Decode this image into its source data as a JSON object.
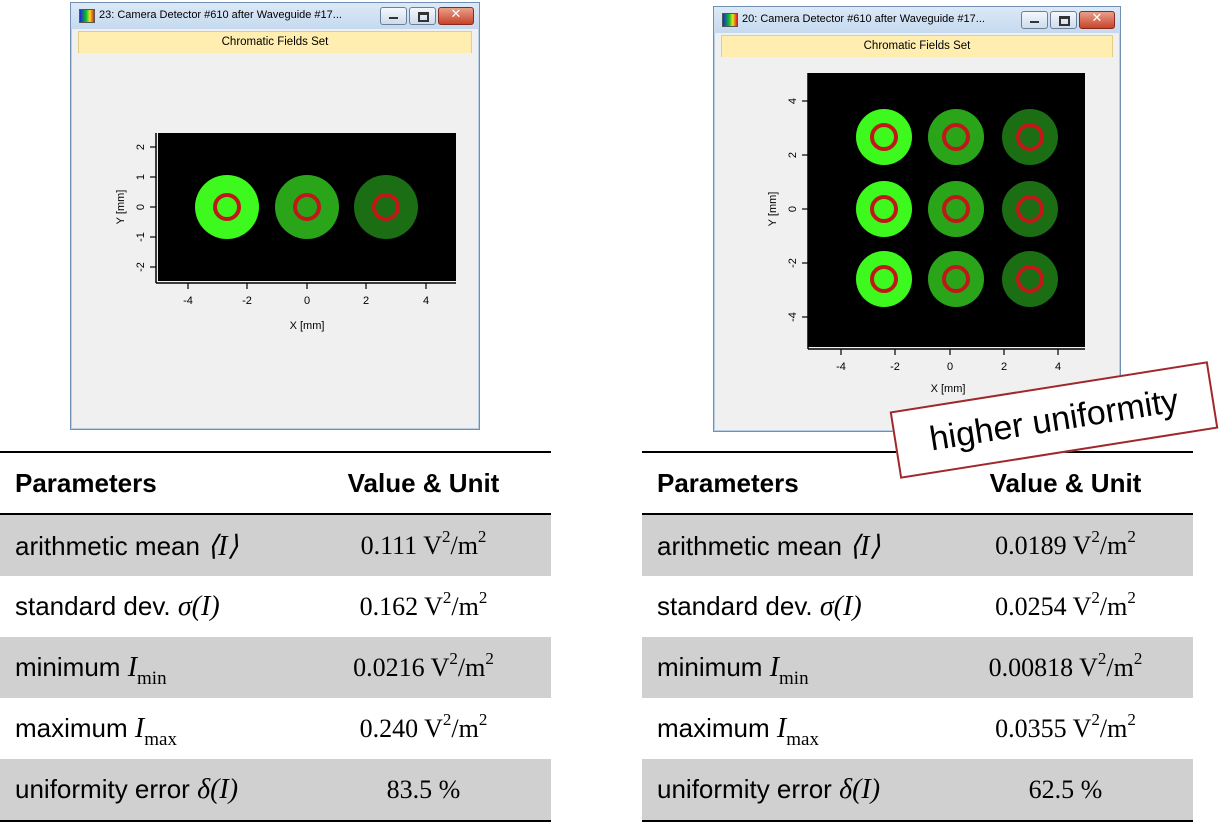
{
  "windows": [
    {
      "title": "23: Camera Detector #610 after Waveguide #17...",
      "subtitle": "Chromatic Fields Set",
      "plot": {
        "xlabel": "X [mm]",
        "ylabel": "Y [mm]",
        "xticks": [
          "-4",
          "-2",
          "0",
          "2",
          "4"
        ],
        "yticks": [
          "2",
          "1",
          "0",
          "-1",
          "-2"
        ],
        "spot_fills": [
          "#3df91d",
          "#2aa51a",
          "#1b6e13"
        ],
        "ring_color": "#c01818"
      }
    },
    {
      "title": "20: Camera Detector #610 after Waveguide #17...",
      "subtitle": "Chromatic Fields Set",
      "plot": {
        "xlabel": "X [mm]",
        "ylabel": "Y [mm]",
        "xticks": [
          "-4",
          "-2",
          "0",
          "2",
          "4"
        ],
        "yticks": [
          "4",
          "2",
          "0",
          "-2",
          "-4"
        ],
        "spot_fills": [
          "#3df91d",
          "#2aa51a",
          "#1b6e13"
        ],
        "ring_color": "#c01818"
      }
    }
  ],
  "tables": [
    {
      "header": {
        "param": "Parameters",
        "value": "Value & Unit"
      },
      "rows": [
        {
          "label": "arithmetic mean",
          "symbol": "⟨I⟩",
          "value": "0.111"
        },
        {
          "label": "standard dev.",
          "symbol": "σ(I)",
          "value": "0.162"
        },
        {
          "label": "minimum",
          "symbol": "I",
          "subscript": "min",
          "value": "0.0216"
        },
        {
          "label": "maximum",
          "symbol": "I",
          "subscript": "max",
          "value": "0.240"
        },
        {
          "label": "uniformity error",
          "symbol": "δ(I)",
          "value": "83.5 %"
        }
      ]
    },
    {
      "header": {
        "param": "Parameters",
        "value": "Value & Unit"
      },
      "rows": [
        {
          "label": "arithmetic mean",
          "symbol": "⟨I⟩",
          "value": "0.0189"
        },
        {
          "label": "standard dev.",
          "symbol": "σ(I)",
          "value": "0.0254"
        },
        {
          "label": "minimum",
          "symbol": "I",
          "subscript": "min",
          "value": "0.00818"
        },
        {
          "label": "maximum",
          "symbol": "I",
          "subscript": "max",
          "value": "0.0355"
        },
        {
          "label": "uniformity error",
          "symbol": "δ(I)",
          "value": "62.5 %"
        }
      ]
    }
  ],
  "unit": {
    "base": "V",
    "exp": "2",
    "den": "m",
    "den_exp": "2"
  },
  "callout": {
    "text": "higher uniformity",
    "border_color": "#a0282d"
  }
}
